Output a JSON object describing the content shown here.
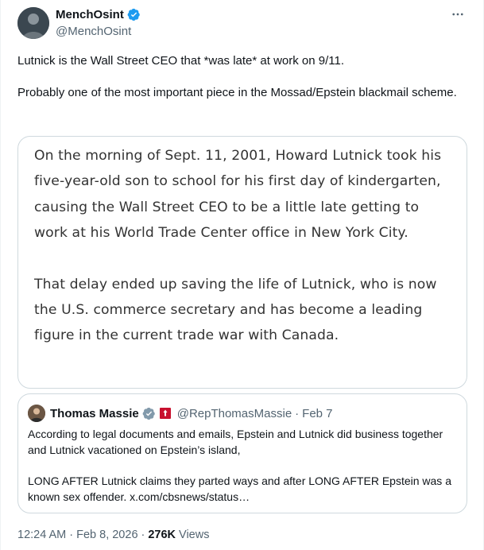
{
  "author": {
    "display_name": "MenchOsint",
    "handle": "@MenchOsint",
    "verified_icon": "verified-badge-icon",
    "avatar_icon": "avatar-person-icon"
  },
  "more_icon": "more-horizontal-icon",
  "tweet": {
    "paragraphs": [
      "Lutnick is the Wall Street CEO that *was late* at work on 9/11.",
      "Probably one of the most important piece in the Mossad/Epstein blackmail scheme."
    ]
  },
  "image_card": {
    "paragraphs": [
      "On the morning of Sept. 11, 2001, Howard Lutnick took his five-year-old son to school for his first day of kindergarten, causing the Wall Street CEO to be a little late getting to work at his World Trade Center office in New York City.",
      "That delay ended up saving the life of Lutnick, who is now the U.S. commerce secretary and has become a leading figure in the current trade war with Canada."
    ]
  },
  "quoted_post": {
    "display_name": "Thomas Massie",
    "handle": "@RepThomasMassie",
    "separator": "·",
    "date": "Feb 7",
    "verified_icon": "verified-badge-gray-icon",
    "affiliate_icon": "government-affiliate-icon",
    "paragraphs": [
      "According to legal documents and emails, Epstein and Lutnick did business together and Lutnick vacationed on Epstein’s island,",
      "LONG AFTER Lutnick claims they parted ways and after LONG AFTER Epstein was a known sex offender. x.com/cbsnews/status…"
    ]
  },
  "meta": {
    "time": "12:24 AM",
    "separator": "·",
    "date": "Feb 8, 2026",
    "views_count": "276K",
    "views_label": "Views"
  },
  "colors": {
    "text": "#0f1419",
    "secondary": "#536471",
    "border": "#cfd9de",
    "verified_blue": "#1d9bf0",
    "verified_gray": "#829aab",
    "affiliate_red": "#c8102e"
  }
}
